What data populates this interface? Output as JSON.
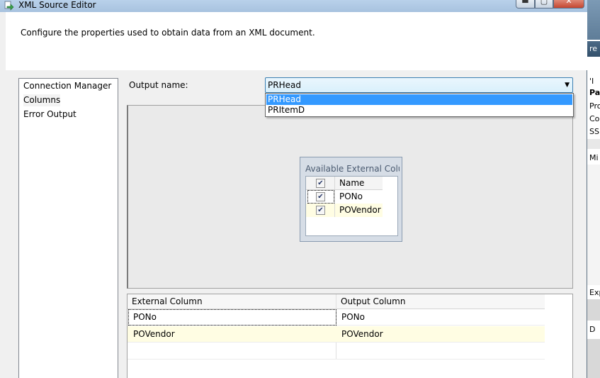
{
  "window": {
    "title": "XML Source Editor",
    "buttons": {
      "minimize": "▬",
      "maximize": "▢",
      "close": "✕"
    }
  },
  "header": {
    "description": "Configure the properties used to obtain data from an XML document."
  },
  "nav": {
    "items": [
      {
        "label": "Connection Manager"
      },
      {
        "label": "Columns",
        "selected": true
      },
      {
        "label": "Error Output"
      }
    ]
  },
  "output": {
    "label": "Output name:",
    "selected": "PRHead",
    "options": [
      "PRHead",
      "PRItemD"
    ]
  },
  "available_columns": {
    "title": "Available External Columns",
    "header": "Name",
    "rows": [
      {
        "name": "PONo",
        "checked": true
      },
      {
        "name": "POVendor",
        "checked": true
      }
    ]
  },
  "mapping_table": {
    "columns": [
      "External Column",
      "Output Column"
    ],
    "rows": [
      [
        "PONo",
        "PONo"
      ],
      [
        "POVendor",
        "POVendor"
      ]
    ]
  },
  "background_app": {
    "fragments": [
      "re",
      "'I",
      "Pa",
      "Pro",
      "Co",
      "SSI",
      "Mi",
      "Exp",
      "D"
    ]
  },
  "colors": {
    "selection": "#3399ff",
    "alt_row": "#fffde3",
    "dialog_bg": "#f0f0f0"
  }
}
